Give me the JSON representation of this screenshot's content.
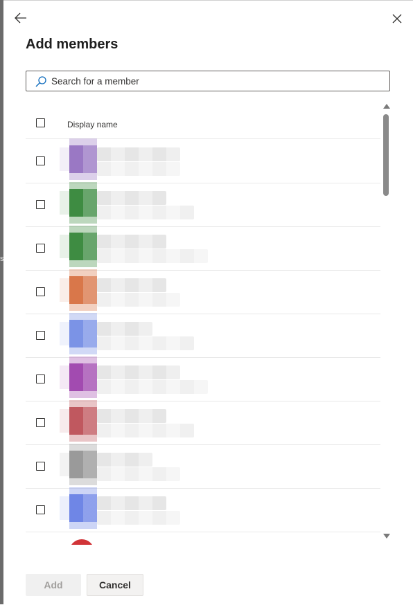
{
  "backdrop": {
    "edge_glyph": "s"
  },
  "panel": {
    "title": "Add members",
    "back_icon": "arrow-left-icon",
    "close_icon": "close-icon"
  },
  "search": {
    "placeholder": "Search for a member",
    "value": "",
    "icon": "search-icon"
  },
  "list": {
    "column_header": "Display name",
    "members": [
      {
        "avatar_color": "#9a78c4",
        "name": "",
        "email": "",
        "redacted": true
      },
      {
        "avatar_color": "#3e8c42",
        "name": "",
        "email": "",
        "redacted": true
      },
      {
        "avatar_color": "#3e8c42",
        "name": "",
        "email": "",
        "redacted": true
      },
      {
        "avatar_color": "#d9774a",
        "name": "",
        "email": "",
        "redacted": true
      },
      {
        "avatar_color": "#7b93e6",
        "name": "",
        "email": "",
        "redacted": true
      },
      {
        "avatar_color": "#a24bb0",
        "name": "",
        "email": "",
        "redacted": true
      },
      {
        "avatar_color": "#c0585f",
        "name": "",
        "email": "",
        "redacted": true
      },
      {
        "avatar_color": "#9a9a9a",
        "name": "",
        "email": "",
        "redacted": true
      },
      {
        "avatar_color": "#6f86e6",
        "name": "",
        "email": "",
        "redacted": true
      },
      {
        "avatar_color": "#d13438",
        "name": "",
        "email": "",
        "redacted": true
      }
    ]
  },
  "footer": {
    "add_label": "Add",
    "cancel_label": "Cancel"
  }
}
